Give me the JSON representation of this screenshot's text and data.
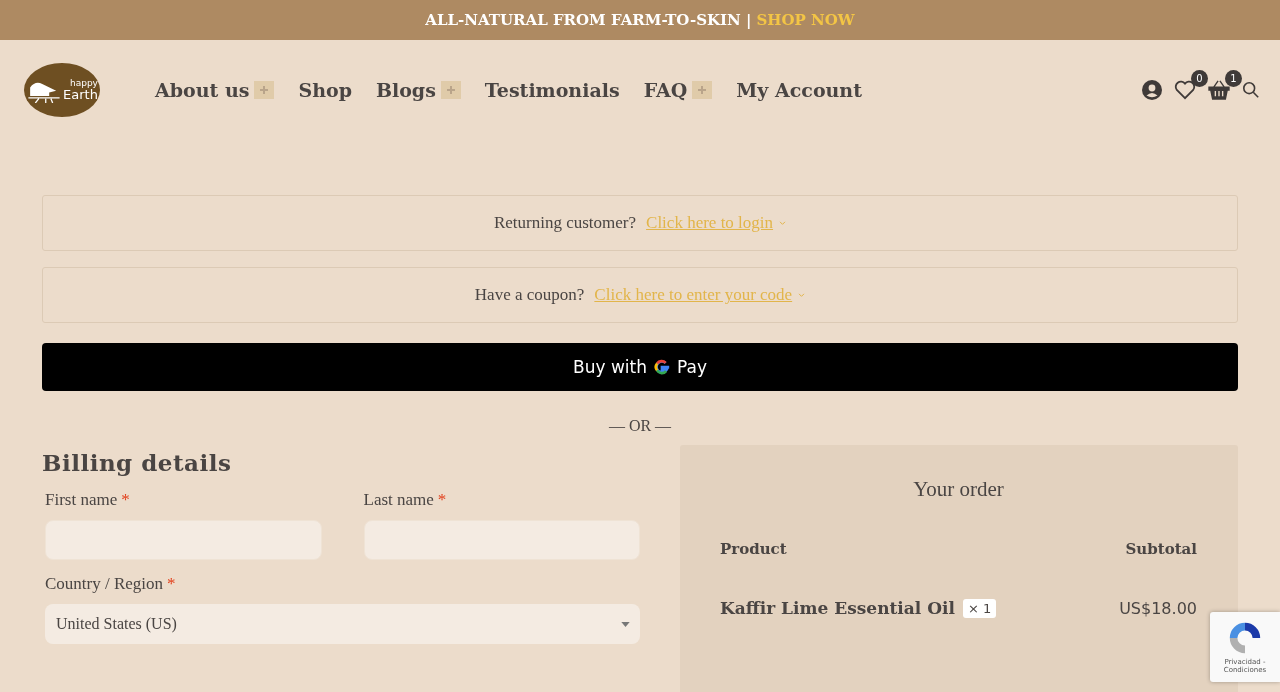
{
  "announcement": {
    "text": "ALL-NATURAL FROM FARM-TO-SKIN |",
    "link": "SHOP NOW"
  },
  "logo": {
    "line1": "happy",
    "line2": "Earth"
  },
  "nav": [
    {
      "label": "About us",
      "expandable": true
    },
    {
      "label": "Shop",
      "expandable": false
    },
    {
      "label": "Blogs",
      "expandable": true
    },
    {
      "label": "Testimonials",
      "expandable": false
    },
    {
      "label": "FAQ",
      "expandable": true
    },
    {
      "label": "My Account",
      "expandable": false
    }
  ],
  "header_icons": {
    "wishlist_count": "0",
    "cart_count": "1"
  },
  "notices": [
    {
      "text": "Returning customer?",
      "link": "Click here to login"
    },
    {
      "text": "Have a coupon?",
      "link": "Click here to enter your code"
    }
  ],
  "gpay": {
    "label": "Buy with",
    "brand": "Pay"
  },
  "separator": "— OR —",
  "billing": {
    "title": "Billing details",
    "fields": [
      {
        "kind": "text",
        "label": "First name",
        "required_mark": "*"
      },
      {
        "kind": "text",
        "label": "Last name",
        "required_mark": "*"
      },
      {
        "kind": "select",
        "label": "Country / Region",
        "required_mark": "*",
        "value": "United States (US)"
      }
    ]
  },
  "order": {
    "title": "Your order",
    "columns": [
      "Product",
      "Subtotal"
    ],
    "items": [
      {
        "name": "Kaffir Lime Essential Oil",
        "qty": "× 1",
        "price": "US$18.00"
      }
    ]
  },
  "recaptcha": {
    "links": "Privacidad - Condiciones"
  }
}
